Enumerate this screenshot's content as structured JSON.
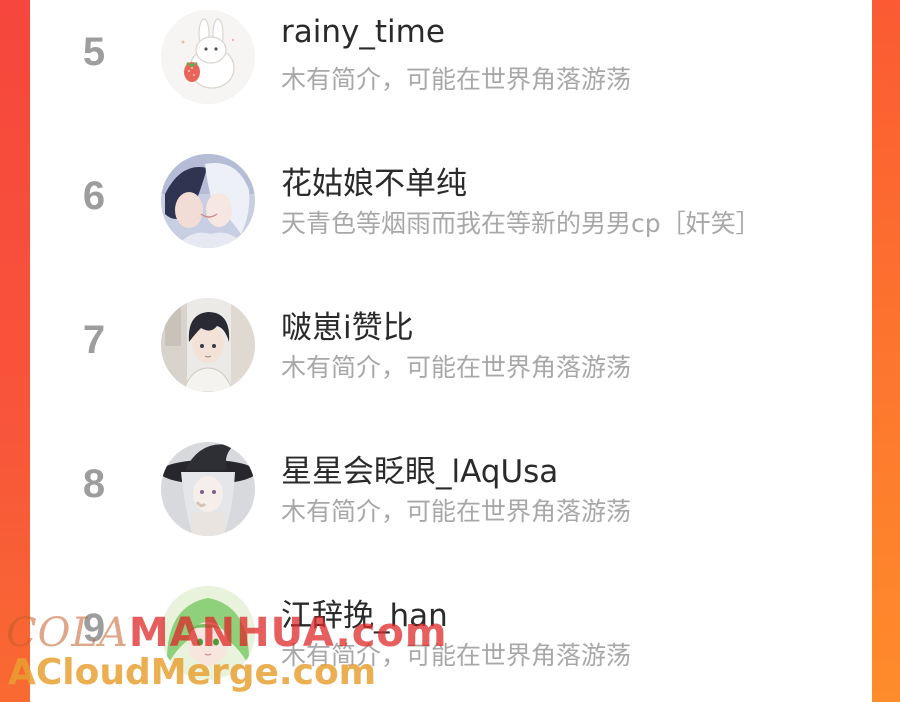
{
  "ranking": [
    {
      "rank": "5",
      "name": "rainy_time",
      "bio": "木有简介，可能在世界角落游荡",
      "avatar_icon": "white-rabbit-strawberry-avatar"
    },
    {
      "rank": "6",
      "name": "花姑娘不单纯",
      "bio": "天青色等烟雨而我在等新的男男cp［奸笑］",
      "avatar_icon": "anime-couple-avatar"
    },
    {
      "rank": "7",
      "name": "啵崽i赞比",
      "bio": "木有简介，可能在世界角落游荡",
      "avatar_icon": "anime-boy-dark-hair-avatar"
    },
    {
      "rank": "8",
      "name": "星星会眨眼_lAqUsa",
      "bio": "木有简介，可能在世界角落游荡",
      "avatar_icon": "anime-witch-hat-avatar"
    },
    {
      "rank": "9",
      "name": "江辞挽_han",
      "bio": "木有简介，可能在世界角落游荡",
      "avatar_icon": "anime-green-hair-avatar"
    }
  ],
  "watermark": {
    "line1_prefix": "COLA",
    "line1_accent": "MANHUA.com",
    "line2": "ACloudMerge.com"
  },
  "colors": {
    "page_edge": "#f7453a",
    "page_edge_right": "#fd7a2d",
    "rank_text": "#9d9d9d",
    "name_text": "#2a2a2a",
    "bio_text": "#a8a8a8"
  }
}
